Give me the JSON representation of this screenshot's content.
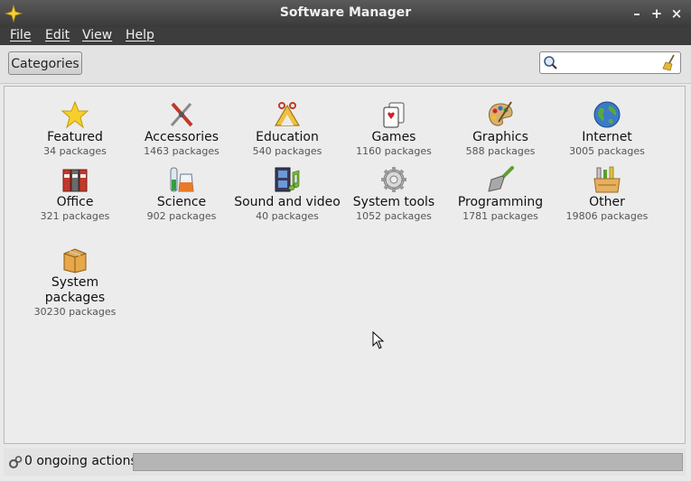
{
  "window": {
    "title": "Software Manager",
    "minimize": "–",
    "maximize": "+",
    "close": "×"
  },
  "menu": [
    {
      "label": "File"
    },
    {
      "label": "Edit"
    },
    {
      "label": "View"
    },
    {
      "label": "Help"
    }
  ],
  "toolbar": {
    "categories_label": "Categories",
    "search_value": "",
    "search_placeholder": ""
  },
  "categories": [
    {
      "name": "Featured",
      "count": "34 packages",
      "icon": "star-icon"
    },
    {
      "name": "Accessories",
      "count": "1463 packages",
      "icon": "tools-icon"
    },
    {
      "name": "Education",
      "count": "540 packages",
      "icon": "education-icon"
    },
    {
      "name": "Games",
      "count": "1160 packages",
      "icon": "cards-icon"
    },
    {
      "name": "Graphics",
      "count": "588 packages",
      "icon": "palette-icon"
    },
    {
      "name": "Internet",
      "count": "3005 packages",
      "icon": "globe-icon"
    },
    {
      "name": "Office",
      "count": "321 packages",
      "icon": "binders-icon"
    },
    {
      "name": "Science",
      "count": "902 packages",
      "icon": "flask-icon"
    },
    {
      "name": "Sound and video",
      "count": "40 packages",
      "icon": "film-music-icon"
    },
    {
      "name": "System tools",
      "count": "1052 packages",
      "icon": "gear-icon"
    },
    {
      "name": "Programming",
      "count": "1781 packages",
      "icon": "trowel-icon"
    },
    {
      "name": "Other",
      "count": "19806 packages",
      "icon": "box-tools-icon"
    },
    {
      "name": "System packages",
      "count": "30230 packages",
      "icon": "package-icon"
    }
  ],
  "status": {
    "text": "0 ongoing actions",
    "progress": 0
  },
  "colors": {
    "titlebar": "#3a3a3a",
    "menubar": "#3d3d3d",
    "content_bg": "#ececec",
    "progress_track": "#b5b5b5"
  }
}
